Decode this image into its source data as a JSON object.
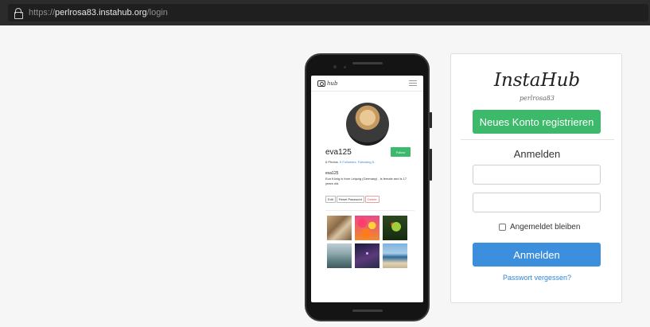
{
  "browser": {
    "url_prefix": "https://",
    "url_host": "perlrosa83.instahub.org",
    "url_path": "/login"
  },
  "phone_preview": {
    "username": "eva125",
    "follow_label": "Follow",
    "stats": {
      "photos": "6 Photos.",
      "followers": "5 Followers.",
      "following": "Following 5."
    },
    "bio_name": "eva125",
    "bio_text": "Eva König is from Leipzig (Germany) , is female and is 17 years old.",
    "buttons": {
      "edit": "Edit",
      "reset_password": "Reset Password",
      "delete": "Delete"
    },
    "icons": [
      "camera-logo-icon",
      "hamburger-menu-icon"
    ]
  },
  "login_panel": {
    "brand": "InstaHub",
    "subdomain": "perlrosa83",
    "register_label": "Neues Konto registrieren",
    "title": "Anmelden",
    "username_value": "",
    "password_value": "",
    "remember_label": "Angemeldet bleiben",
    "remember_checked": false,
    "submit_label": "Anmelden",
    "forgot_label": "Passwort vergessen?",
    "colors": {
      "register": "#3cb96b",
      "submit": "#3b8fdd",
      "link": "#2f86d6"
    }
  }
}
